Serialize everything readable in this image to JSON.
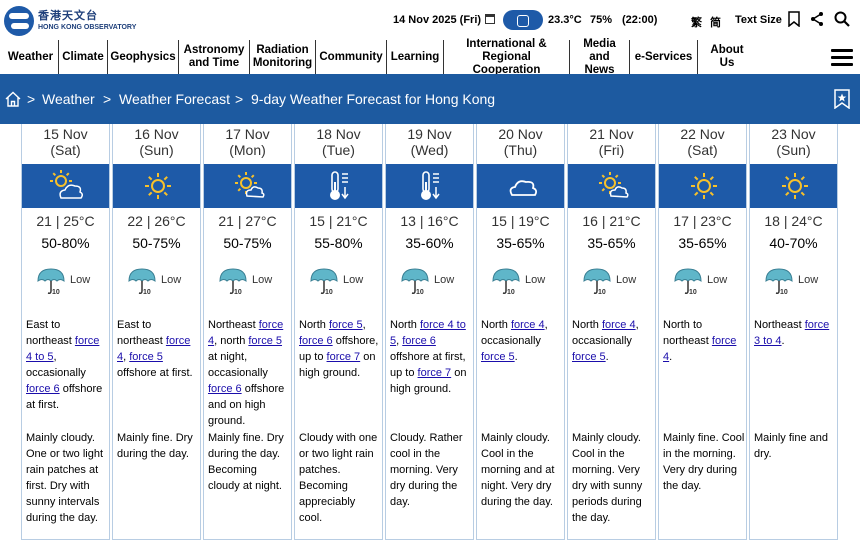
{
  "header": {
    "logo_zh": "香港天文台",
    "logo_en": "HONG KONG OBSERVATORY",
    "date": "14 Nov 2025 (Fri)",
    "temperature": "23.3°C",
    "humidity": "75%",
    "time": "(22:00)",
    "lang_tc": "繁",
    "lang_sc": "简",
    "text_size": "Text Size"
  },
  "nav": {
    "items": [
      {
        "label": "Weather"
      },
      {
        "label": "Climate"
      },
      {
        "label": "Geophysics"
      },
      {
        "label": "Astronomy and Time"
      },
      {
        "label": "Radiation Monitoring"
      },
      {
        "label": "Community"
      },
      {
        "label": "Learning"
      },
      {
        "label": "International & Regional Cooperation"
      },
      {
        "label": "Media and News"
      },
      {
        "label": "e-Services"
      },
      {
        "label": "About Us"
      }
    ]
  },
  "breadcrumb": {
    "sep": ">",
    "items": [
      "Weather",
      "Weather Forecast",
      "9-day Weather Forecast for Hong Kong"
    ]
  },
  "forecast": {
    "psr_label": "Low",
    "days": [
      {
        "date": "15 Nov",
        "dow": "(Sat)",
        "icon": "sunny-periods-cloudy-icon",
        "temp": "21 | 25°C",
        "rh": "50-80%",
        "wind_parts": [
          [
            "East to northeast ",
            false
          ],
          [
            "force 4 to 5",
            true
          ],
          [
            ", occasionally ",
            false
          ],
          [
            "force 6",
            true
          ],
          [
            " offshore at first.",
            false
          ]
        ],
        "weather": "Mainly cloudy. One or two light rain patches at first. Dry with sunny intervals during the day."
      },
      {
        "date": "16 Nov",
        "dow": "(Sun)",
        "icon": "sunny-icon",
        "temp": "22 | 26°C",
        "rh": "50-75%",
        "wind_parts": [
          [
            "East to northeast ",
            false
          ],
          [
            "force 4",
            true
          ],
          [
            ", ",
            false
          ],
          [
            "force 5",
            true
          ],
          [
            " offshore at first.",
            false
          ]
        ],
        "weather": "Mainly fine. Dry during the day."
      },
      {
        "date": "17 Nov",
        "dow": "(Mon)",
        "icon": "sunny-periods-icon",
        "temp": "21 | 27°C",
        "rh": "50-75%",
        "wind_parts": [
          [
            "Northeast ",
            false
          ],
          [
            "force 4",
            true
          ],
          [
            ", north ",
            false
          ],
          [
            "force 5",
            true
          ],
          [
            " at night, occasionally ",
            false
          ],
          [
            "force 6",
            true
          ],
          [
            " offshore and on high ground.",
            false
          ]
        ],
        "weather": "Mainly fine. Dry during the day. Becoming cloudy at night."
      },
      {
        "date": "18 Nov",
        "dow": "(Tue)",
        "icon": "cold-icon",
        "temp": "15 | 21°C",
        "rh": "55-80%",
        "wind_parts": [
          [
            "North ",
            false
          ],
          [
            "force 5",
            true
          ],
          [
            ", ",
            false
          ],
          [
            "force 6",
            true
          ],
          [
            " offshore, up to ",
            false
          ],
          [
            "force 7",
            true
          ],
          [
            " on high ground.",
            false
          ]
        ],
        "weather": "Cloudy with one or two light rain patches. Becoming appreciably cool."
      },
      {
        "date": "19 Nov",
        "dow": "(Wed)",
        "icon": "cold-icon",
        "temp": "13 | 16°C",
        "rh": "35-60%",
        "wind_parts": [
          [
            "North ",
            false
          ],
          [
            "force 4 to 5",
            true
          ],
          [
            ", ",
            false
          ],
          [
            "force 6",
            true
          ],
          [
            " offshore at first, up to ",
            false
          ],
          [
            "force 7",
            true
          ],
          [
            " on high ground.",
            false
          ]
        ],
        "weather": "Cloudy. Rather cool in the morning. Very dry during the day."
      },
      {
        "date": "20 Nov",
        "dow": "(Thu)",
        "icon": "cloudy-icon",
        "temp": "15 | 19°C",
        "rh": "35-65%",
        "wind_parts": [
          [
            "North ",
            false
          ],
          [
            "force 4",
            true
          ],
          [
            ", occasionally ",
            false
          ],
          [
            "force 5",
            true
          ],
          [
            ".",
            false
          ]
        ],
        "weather": "Mainly cloudy. Cool in the morning and at night. Very dry during the day."
      },
      {
        "date": "21 Nov",
        "dow": "(Fri)",
        "icon": "sunny-periods-icon",
        "temp": "16 | 21°C",
        "rh": "35-65%",
        "wind_parts": [
          [
            "North ",
            false
          ],
          [
            "force 4",
            true
          ],
          [
            ", occasionally ",
            false
          ],
          [
            "force 5",
            true
          ],
          [
            ".",
            false
          ]
        ],
        "weather": "Mainly cloudy. Cool in the morning. Very dry with sunny periods during the day."
      },
      {
        "date": "22 Nov",
        "dow": "(Sat)",
        "icon": "sunny-icon",
        "temp": "17 | 23°C",
        "rh": "35-65%",
        "wind_parts": [
          [
            "North to northeast ",
            false
          ],
          [
            "force 4",
            true
          ],
          [
            ".",
            false
          ]
        ],
        "weather": "Mainly fine. Cool in the morning. Very dry during the day."
      },
      {
        "date": "23 Nov",
        "dow": "(Sun)",
        "icon": "sunny-icon",
        "temp": "18 | 24°C",
        "rh": "40-70%",
        "wind_parts": [
          [
            "Northeast ",
            false
          ],
          [
            "force 3 to 4",
            true
          ],
          [
            ".",
            false
          ]
        ],
        "weather": "Mainly fine and dry."
      }
    ]
  }
}
